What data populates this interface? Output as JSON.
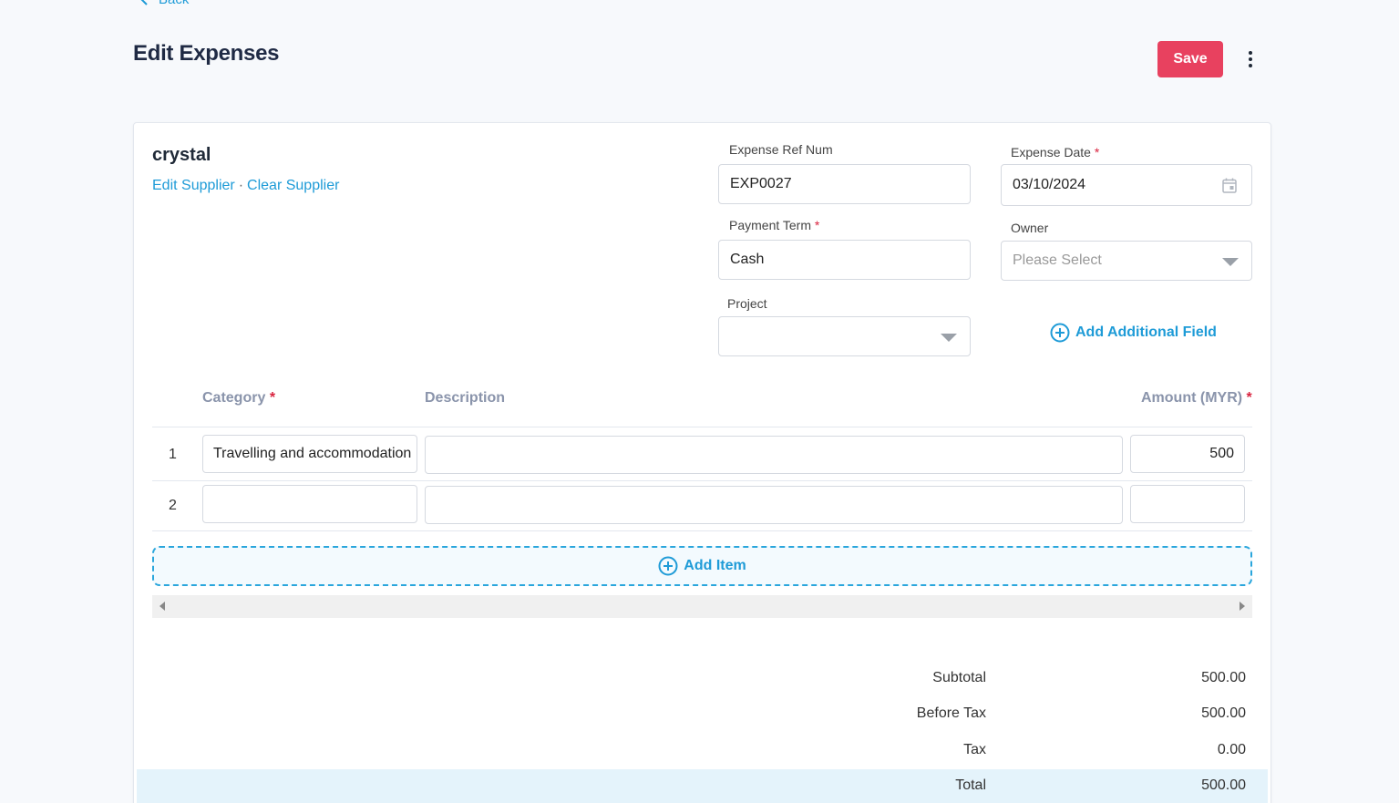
{
  "header": {
    "back_label": "Back",
    "title": "Edit Expenses",
    "save_label": "Save"
  },
  "supplier": {
    "name": "crystal",
    "edit_label": "Edit Supplier",
    "separator": "·",
    "clear_label": "Clear Supplier"
  },
  "fields": {
    "ref_num": {
      "label": "Expense Ref Num",
      "value": "EXP0027"
    },
    "expense_date": {
      "label": "Expense Date",
      "required": "*",
      "value": "03/10/2024"
    },
    "payment_term": {
      "label": "Payment Term",
      "required": "*",
      "value": "Cash"
    },
    "owner": {
      "label": "Owner",
      "placeholder": "Please Select"
    },
    "project": {
      "label": "Project",
      "value": ""
    },
    "add_field_label": "Add Additional Field"
  },
  "table": {
    "columns": {
      "category": "Category",
      "category_required": "*",
      "description": "Description",
      "amount": "Amount (MYR)",
      "amount_required": "*"
    },
    "rows": [
      {
        "num": "1",
        "category": "Travelling and accommodation",
        "description": "",
        "amount": "500"
      },
      {
        "num": "2",
        "category": "",
        "description": "",
        "amount": ""
      }
    ],
    "add_item_label": "Add Item"
  },
  "summary": {
    "subtotal_label": "Subtotal",
    "subtotal": "500.00",
    "before_tax_label": "Before Tax",
    "before_tax": "500.00",
    "tax_label": "Tax",
    "tax": "0.00",
    "total_label": "Total",
    "total": "500.00"
  },
  "colors": {
    "accent": "#1e9bd7",
    "save": "#e8415f",
    "required": "#d9233f",
    "total_bg": "#e4f3fb"
  }
}
